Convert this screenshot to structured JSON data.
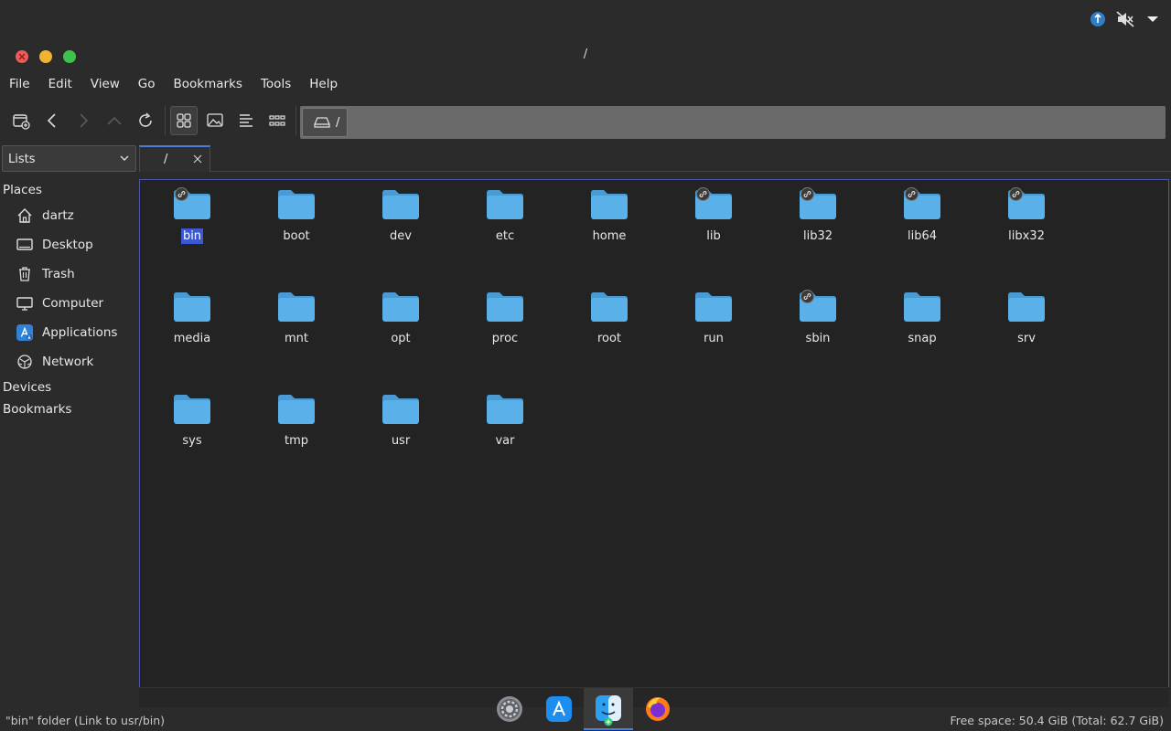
{
  "window": {
    "title": "/"
  },
  "menubar": [
    "File",
    "Edit",
    "View",
    "Go",
    "Bookmarks",
    "Tools",
    "Help"
  ],
  "pathbar": {
    "segment": "/"
  },
  "sidebar_mode": {
    "selected": "Lists"
  },
  "sidebar": {
    "places_label": "Places",
    "items": [
      {
        "label": "dartz",
        "icon": "home-icon"
      },
      {
        "label": "Desktop",
        "icon": "desktop-icon"
      },
      {
        "label": "Trash",
        "icon": "trash-icon"
      },
      {
        "label": "Computer",
        "icon": "computer-icon"
      },
      {
        "label": "Applications",
        "icon": "applications-icon"
      },
      {
        "label": "Network",
        "icon": "network-icon"
      }
    ],
    "devices_label": "Devices",
    "bookmarks_label": "Bookmarks"
  },
  "tab": {
    "label": "/"
  },
  "files": [
    {
      "name": "bin",
      "link": true,
      "selected": true
    },
    {
      "name": "boot",
      "link": false
    },
    {
      "name": "dev",
      "link": false
    },
    {
      "name": "etc",
      "link": false
    },
    {
      "name": "home",
      "link": false
    },
    {
      "name": "lib",
      "link": true
    },
    {
      "name": "lib32",
      "link": true
    },
    {
      "name": "lib64",
      "link": true
    },
    {
      "name": "libx32",
      "link": true
    },
    {
      "name": "media",
      "link": false
    },
    {
      "name": "mnt",
      "link": false
    },
    {
      "name": "opt",
      "link": false
    },
    {
      "name": "proc",
      "link": false
    },
    {
      "name": "root",
      "link": false
    },
    {
      "name": "run",
      "link": false
    },
    {
      "name": "sbin",
      "link": true
    },
    {
      "name": "snap",
      "link": false
    },
    {
      "name": "srv",
      "link": false
    },
    {
      "name": "sys",
      "link": false
    },
    {
      "name": "tmp",
      "link": false
    },
    {
      "name": "usr",
      "link": false
    },
    {
      "name": "var",
      "link": false
    }
  ],
  "status": {
    "left": "\"bin\" folder (Link to usr/bin)",
    "right": "Free space: 50.4 GiB (Total: 62.7 GiB)"
  },
  "colors": {
    "folder": "#5ab0e8",
    "folder_tab": "#4a9ad6",
    "selection": "#3d59d1",
    "accent": "#4a7fd8"
  }
}
